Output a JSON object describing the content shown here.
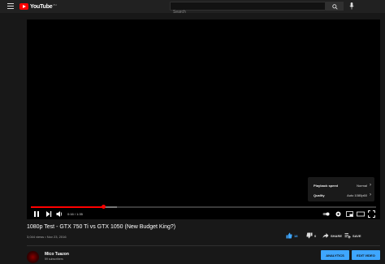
{
  "header": {
    "logo_text": "YouTube",
    "logo_country": "PH",
    "search_placeholder": "Search"
  },
  "player": {
    "settings_menu": {
      "speed_label": "Playback speed",
      "speed_value": "Normal",
      "quality_label": "Quality",
      "quality_value": "Auto 1080p60"
    },
    "progress": {
      "played_fraction": 0.21,
      "loaded_fraction": 0.25
    },
    "time_display": "0:16 / 1:35"
  },
  "video": {
    "title": "1080p Test - GTX 750 Ti vs GTX 1050 (New Budget King?)",
    "meta": "3,044 views • Nov 23, 2016",
    "likes": "18",
    "dislikes": "0",
    "share_label": "SHARE",
    "save_label": "SAVE"
  },
  "channel": {
    "name": "Mico Tuazon",
    "subscribers": "59 subscribers",
    "analytics_label": "ANALYTICS",
    "edit_label": "EDIT VIDEO"
  },
  "colors": {
    "accent": "#3ea6ff",
    "brand": "#ff0000",
    "background": "#181818"
  }
}
